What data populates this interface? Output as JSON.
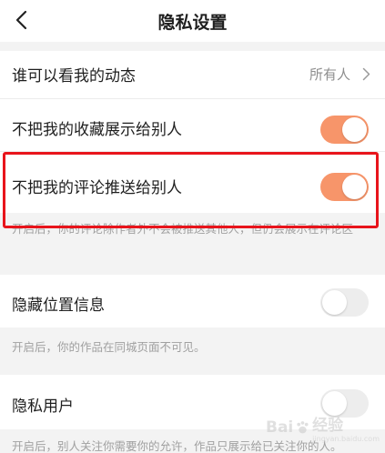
{
  "header": {
    "title": "隐私设置"
  },
  "settings": {
    "who_can_see": {
      "label": "谁可以看我的动态",
      "value": "所有人"
    },
    "hide_favorites": {
      "label": "不把我的收藏展示给别人",
      "enabled": true
    },
    "hide_comments": {
      "label": "不把我的评论推送给别人",
      "enabled": true,
      "note": "开启后，你的评论除作者外不会被推送其他人，但仍会展示在评论区"
    },
    "hide_location": {
      "label": "隐藏位置信息",
      "enabled": false,
      "note": "开启后，你的作品在同城页面不可见。"
    },
    "private_user": {
      "label": "隐私用户",
      "enabled": false,
      "note": "开启后，别人关注你需要你的允许，作品只展示给已关注你的人。"
    }
  },
  "watermark": {
    "text": "Bai",
    "text2": "经验",
    "sub": "jingyan.baidu.com"
  },
  "colors": {
    "toggle_on": "#f7956a",
    "toggle_off": "#ededed",
    "highlight_border": "#e8141b"
  }
}
